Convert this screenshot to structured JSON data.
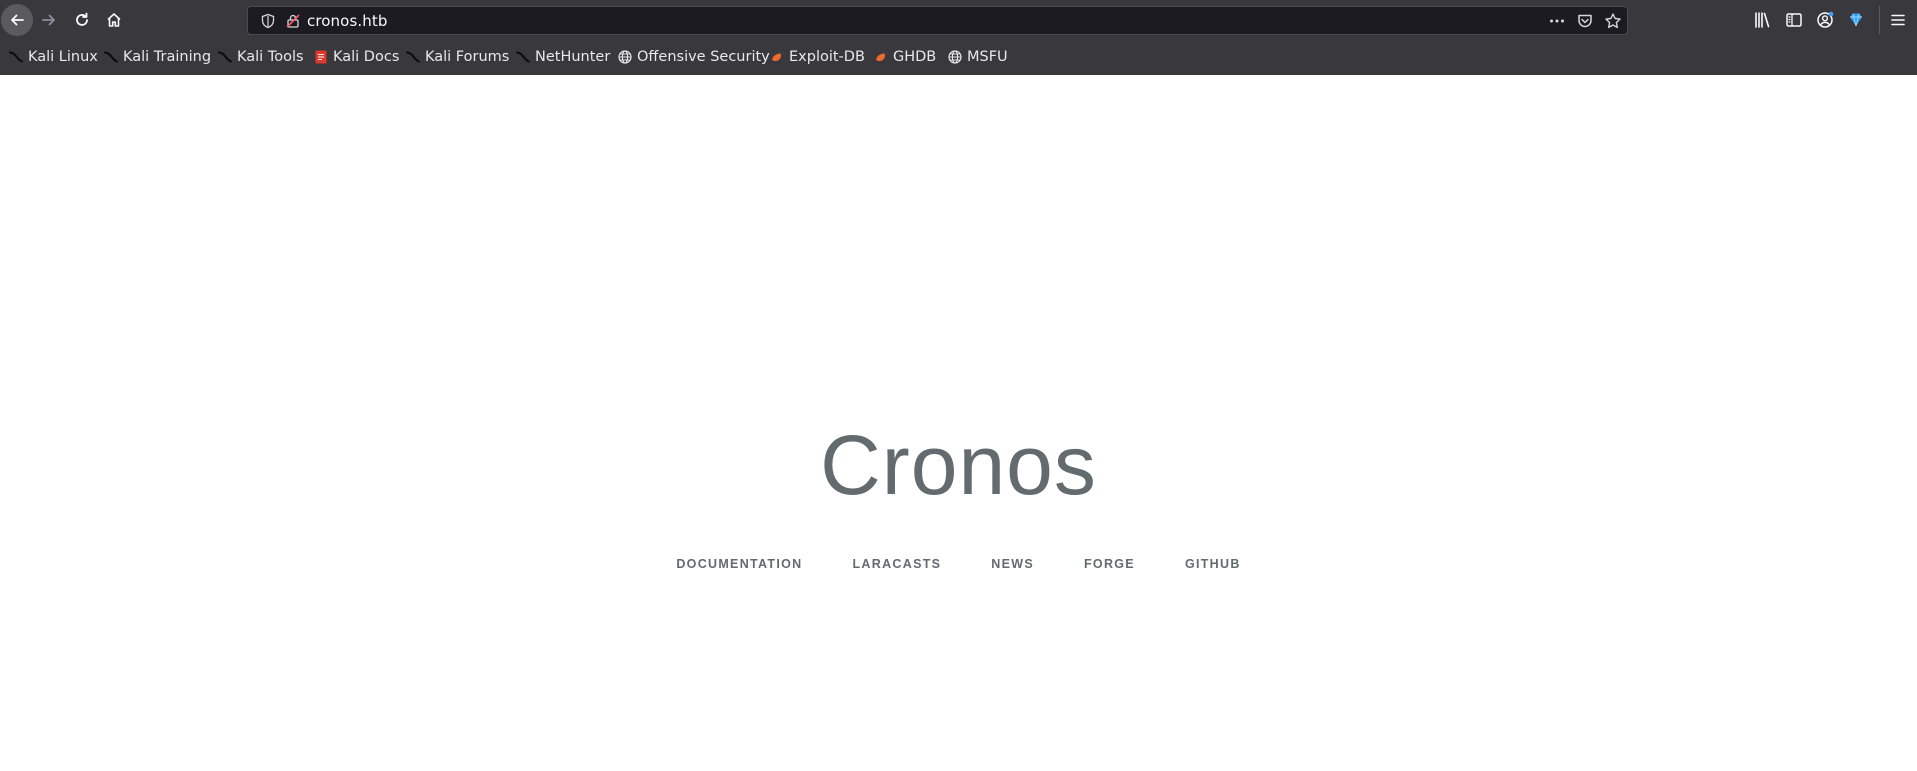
{
  "browser": {
    "url": "cronos.htb",
    "bookmarks": [
      {
        "label": "Kali Linux",
        "icon": "kali-dragon-icon"
      },
      {
        "label": "Kali Training",
        "icon": "kali-dragon-icon"
      },
      {
        "label": "Kali Tools",
        "icon": "kali-dragon-icon"
      },
      {
        "label": "Kali Docs",
        "icon": "kali-docs-icon"
      },
      {
        "label": "Kali Forums",
        "icon": "kali-dragon-icon"
      },
      {
        "label": "NetHunter",
        "icon": "kali-dragon-icon"
      },
      {
        "label": "Offensive Security",
        "icon": "globe-icon"
      },
      {
        "label": "Exploit-DB",
        "icon": "exploit-db-icon"
      },
      {
        "label": "GHDB",
        "icon": "exploit-db-icon"
      },
      {
        "label": "MSFU",
        "icon": "globe-icon"
      }
    ]
  },
  "page": {
    "title": "Cronos",
    "links": [
      "Documentation",
      "Laracasts",
      "News",
      "Forge",
      "GitHub"
    ]
  },
  "colors": {
    "chrome": "#38383d",
    "urlbar": "#1c1b22",
    "page_text": "#636b6f"
  }
}
